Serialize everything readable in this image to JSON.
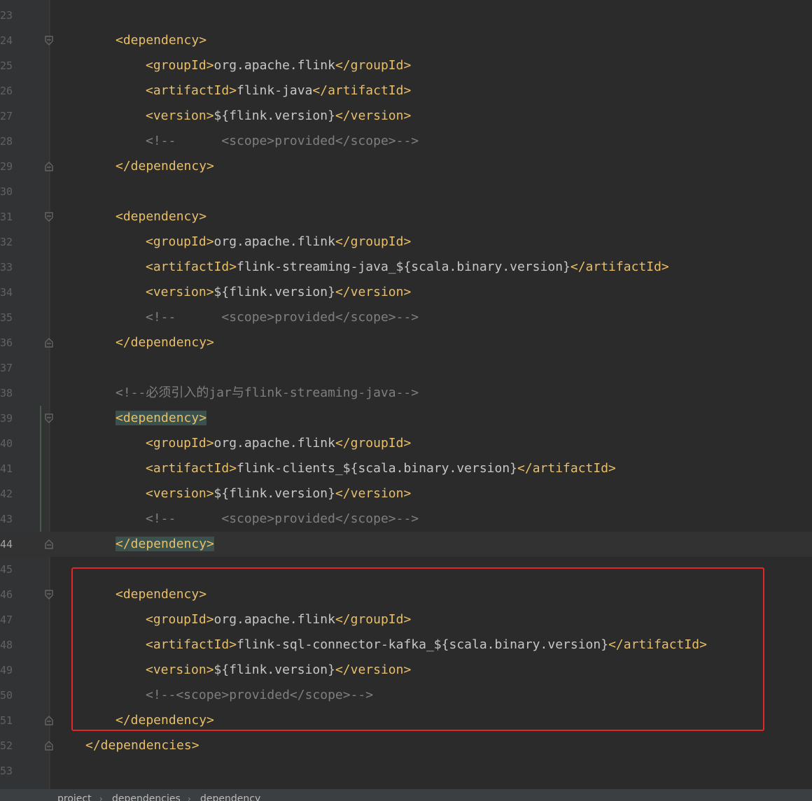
{
  "lines": [
    {
      "n": "23",
      "parts": []
    },
    {
      "n": "24",
      "fold": "open",
      "parts": [
        {
          "t": "<dependency>",
          "c": "tag"
        }
      ],
      "indent": 1
    },
    {
      "n": "25",
      "parts": [
        {
          "t": "<groupId>",
          "c": "tag"
        },
        {
          "t": "org.apache.flink",
          "c": "val"
        },
        {
          "t": "</groupId>",
          "c": "tag"
        }
      ],
      "indent": 2
    },
    {
      "n": "26",
      "parts": [
        {
          "t": "<artifactId>",
          "c": "tag"
        },
        {
          "t": "flink-java",
          "c": "val"
        },
        {
          "t": "</artifactId>",
          "c": "tag"
        }
      ],
      "indent": 2
    },
    {
      "n": "27",
      "parts": [
        {
          "t": "<version>",
          "c": "tag"
        },
        {
          "t": "${flink.version}",
          "c": "val"
        },
        {
          "t": "</version>",
          "c": "tag"
        }
      ],
      "indent": 2
    },
    {
      "n": "28",
      "parts": [
        {
          "t": "<!--      <scope>provided</scope>-->",
          "c": "com"
        }
      ],
      "indent": 2
    },
    {
      "n": "29",
      "fold": "close",
      "parts": [
        {
          "t": "</dependency>",
          "c": "tag"
        }
      ],
      "indent": 1
    },
    {
      "n": "30",
      "parts": []
    },
    {
      "n": "31",
      "fold": "open",
      "parts": [
        {
          "t": "<dependency>",
          "c": "tag"
        }
      ],
      "indent": 1
    },
    {
      "n": "32",
      "parts": [
        {
          "t": "<groupId>",
          "c": "tag"
        },
        {
          "t": "org.apache.flink",
          "c": "val"
        },
        {
          "t": "</groupId>",
          "c": "tag"
        }
      ],
      "indent": 2
    },
    {
      "n": "33",
      "parts": [
        {
          "t": "<artifactId>",
          "c": "tag"
        },
        {
          "t": "flink-streaming-java_${scala.binary.version}",
          "c": "val"
        },
        {
          "t": "</artifactId>",
          "c": "tag"
        }
      ],
      "indent": 2
    },
    {
      "n": "34",
      "parts": [
        {
          "t": "<version>",
          "c": "tag"
        },
        {
          "t": "${flink.version}",
          "c": "val"
        },
        {
          "t": "</version>",
          "c": "tag"
        }
      ],
      "indent": 2
    },
    {
      "n": "35",
      "parts": [
        {
          "t": "<!--      <scope>provided</scope>-->",
          "c": "com"
        }
      ],
      "indent": 2
    },
    {
      "n": "36",
      "fold": "close",
      "parts": [
        {
          "t": "</dependency>",
          "c": "tag"
        }
      ],
      "indent": 1
    },
    {
      "n": "37",
      "parts": []
    },
    {
      "n": "38",
      "parts": [
        {
          "t": "<!--必须引入的jar与flink-streaming-java-->",
          "c": "com"
        }
      ],
      "indent": 1
    },
    {
      "n": "39",
      "fold": "open",
      "parts": [
        {
          "t": "<dependency>",
          "c": "tag",
          "hl": true
        }
      ],
      "indent": 1
    },
    {
      "n": "40",
      "parts": [
        {
          "t": "<groupId>",
          "c": "tag"
        },
        {
          "t": "org.apache.flink",
          "c": "val"
        },
        {
          "t": "</groupId>",
          "c": "tag"
        }
      ],
      "indent": 2
    },
    {
      "n": "41",
      "parts": [
        {
          "t": "<artifactId>",
          "c": "tag"
        },
        {
          "t": "flink-clients_${scala.binary.version}",
          "c": "val"
        },
        {
          "t": "</artifactId>",
          "c": "tag"
        }
      ],
      "indent": 2
    },
    {
      "n": "42",
      "parts": [
        {
          "t": "<version>",
          "c": "tag"
        },
        {
          "t": "${flink.version}",
          "c": "val"
        },
        {
          "t": "</version>",
          "c": "tag"
        }
      ],
      "indent": 2
    },
    {
      "n": "43",
      "parts": [
        {
          "t": "<!--      <scope>provided</scope>-->",
          "c": "com"
        }
      ],
      "indent": 2
    },
    {
      "n": "44",
      "fold": "close",
      "current": true,
      "parts": [
        {
          "t": "</dependency>",
          "c": "tag",
          "hl": true
        }
      ],
      "indent": 1
    },
    {
      "n": "45",
      "parts": []
    },
    {
      "n": "46",
      "fold": "open",
      "parts": [
        {
          "t": "<dependency>",
          "c": "tag"
        }
      ],
      "indent": 1
    },
    {
      "n": "47",
      "parts": [
        {
          "t": "<groupId>",
          "c": "tag"
        },
        {
          "t": "org.apache.flink",
          "c": "val"
        },
        {
          "t": "</groupId>",
          "c": "tag"
        }
      ],
      "indent": 2
    },
    {
      "n": "48",
      "parts": [
        {
          "t": "<artifactId>",
          "c": "tag"
        },
        {
          "t": "flink-sql-connector-kafka_${scala.binary.version}",
          "c": "val"
        },
        {
          "t": "</artifactId>",
          "c": "tag"
        }
      ],
      "indent": 2
    },
    {
      "n": "49",
      "parts": [
        {
          "t": "<version>",
          "c": "tag"
        },
        {
          "t": "${flink.version}",
          "c": "val"
        },
        {
          "t": "</version>",
          "c": "tag"
        }
      ],
      "indent": 2
    },
    {
      "n": "50",
      "parts": [
        {
          "t": "<!--<scope>provided</scope>-->",
          "c": "com"
        }
      ],
      "indent": 2
    },
    {
      "n": "51",
      "fold": "close",
      "parts": [
        {
          "t": "</dependency>",
          "c": "tag"
        }
      ],
      "indent": 1
    },
    {
      "n": "52",
      "fold": "close",
      "parts": [
        {
          "t": "</dependencies>",
          "c": "tag"
        }
      ],
      "indent": 0
    },
    {
      "n": "53",
      "parts": []
    }
  ],
  "breadcrumb": [
    "project",
    "dependencies",
    "dependency"
  ],
  "colors": {
    "tag": "#e8bf6a",
    "value": "#c7c7c7",
    "comment": "#7f7f7f",
    "highlight": "#3b514d",
    "annotation_box": "#e0282b"
  }
}
